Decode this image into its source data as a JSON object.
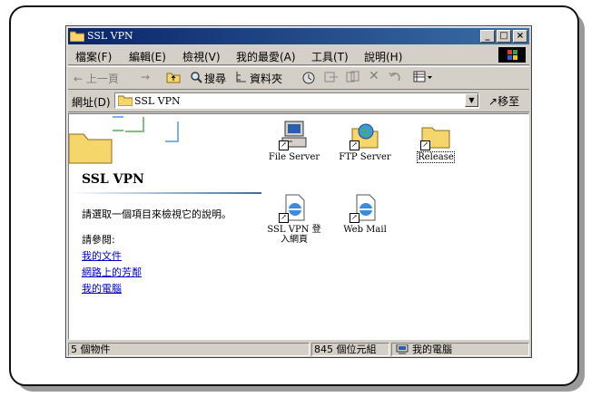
{
  "window": {
    "title": "SSL VPN",
    "controls": {
      "minimize": "_",
      "maximize": "□",
      "close": "×"
    }
  },
  "menu": [
    "檔案(F)",
    "編輯(E)",
    "檢視(V)",
    "我的最愛(A)",
    "工具(T)",
    "說明(H)"
  ],
  "toolbar": {
    "back": "← 上一頁",
    "forward": "→",
    "search": "搜尋",
    "folders": "資料夾"
  },
  "address": {
    "label": "網址(D)",
    "value": "SSL VPN",
    "go": "移至"
  },
  "left_pane": {
    "title": "SSL VPN",
    "description": "請選取一個項目來檢視它的說明。",
    "see_also": "請參閱:",
    "links": [
      "我的文件",
      "網路上的芳鄰",
      "我的電腦"
    ]
  },
  "items": [
    {
      "label": "File Server",
      "icon": "computer-icon"
    },
    {
      "label": "FTP Server",
      "icon": "ftp-globe-icon"
    },
    {
      "label": "Release",
      "icon": "folder-icon"
    },
    {
      "label": "SSL VPN 登入網頁",
      "icon": "ie-page-icon"
    },
    {
      "label": "Web Mail",
      "icon": "ie-page-icon"
    }
  ],
  "status": {
    "count": "5 個物件",
    "size": "845 個位元組",
    "zone": "我的電腦"
  },
  "colors": {
    "titlebar_start": "#0a246a",
    "titlebar_end": "#3a6ea5",
    "link": "#0000cc"
  }
}
